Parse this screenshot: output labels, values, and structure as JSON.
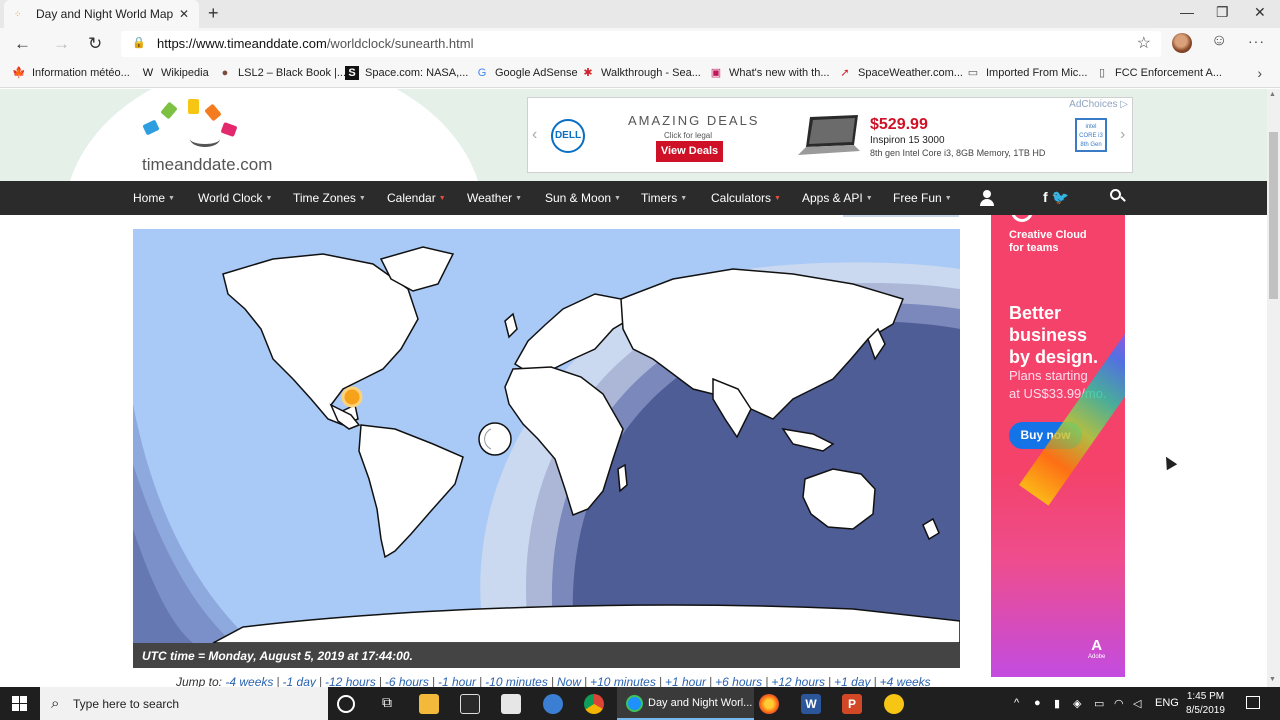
{
  "browser": {
    "tab_title": "Day and Night World Map",
    "new_tab_icon": "+",
    "url_host": "https://www.timeanddate.com",
    "url_path": "/worldclock/sunearth.html",
    "favorites": [
      {
        "label": "Information météo...",
        "icon": "maple-leaf-icon",
        "glyph": "🍁",
        "color": "#d52b1e"
      },
      {
        "label": "Wikipedia",
        "icon": "wikipedia-icon",
        "glyph": "W",
        "color": "#111"
      },
      {
        "label": "LSL2 – Black Book |...",
        "icon": "avatar-icon",
        "glyph": "●",
        "color": "#7a4a3a"
      },
      {
        "label": "Space.com: NASA,...",
        "icon": "space-com-icon",
        "glyph": "S",
        "color": "#fff"
      },
      {
        "label": "Google AdSense",
        "icon": "google-icon",
        "glyph": "G",
        "color": "#4285f4"
      },
      {
        "label": "Walkthrough - Sea...",
        "icon": "walkthrough-icon",
        "glyph": "✱",
        "color": "#d2232a"
      },
      {
        "label": "What's new with th...",
        "icon": "image-icon",
        "glyph": "▣",
        "color": "#c2185b"
      },
      {
        "label": "SpaceWeather.com...",
        "icon": "spaceweather-icon",
        "glyph": "➚",
        "color": "#d2232a"
      },
      {
        "label": "Imported From Mic...",
        "icon": "folder-icon",
        "glyph": "▭",
        "color": "#555"
      },
      {
        "label": "FCC Enforcement A...",
        "icon": "page-icon",
        "glyph": "▯",
        "color": "#555"
      }
    ]
  },
  "site": {
    "logo_text": "timeanddate.com",
    "nav": [
      "Home",
      "World Clock",
      "Time Zones",
      "Calendar",
      "Weather",
      "Sun & Moon",
      "Timers",
      "Calculators",
      "Apps & API",
      "Free Fun"
    ],
    "nav_caret": "▼",
    "social": "f 🐦"
  },
  "top_ad": {
    "adchoices": "AdChoices ▷",
    "brand": "DELL",
    "headline": "AMAZING DEALS",
    "legal": "Click for legal",
    "cta": "View Deals",
    "price": "$529.99",
    "model": "Inspiron 15 3000",
    "specs": "8th gen Intel Core i3, 8GB Memory, 1TB HD",
    "badge": "intel CORE i3 8th Gen",
    "prev": "‹",
    "next": "›"
  },
  "map": {
    "utc_text": "UTC time = Monday, August 5, 2019 at 17:44:00.",
    "jump_label": "Jump to:",
    "jump_links": [
      "-4 weeks",
      "-1 day",
      "-12 hours",
      "-6 hours",
      "-1 hour",
      "-10 minutes",
      "Now",
      "+10 minutes",
      "+1 hour",
      "+6 hours",
      "+12 hours",
      "+1 day",
      "+4 weeks"
    ],
    "colors": {
      "ocean_day": "#a9c9f7",
      "land": "#ffffff",
      "night": "#4f5d96",
      "sun": "#f7a21b"
    }
  },
  "side_ad": {
    "product": "Creative Cloud\nfor teams",
    "headline": "Better\nbusiness\nby design.",
    "plans": "Plans starting\nat US$33.99/mo.",
    "cta": "Buy now",
    "brand": "Adobe",
    "brand_mark": "A"
  },
  "taskbar": {
    "search_placeholder": "Type here to search",
    "active_window": "Day and Night Worl...",
    "lang": "ENG",
    "time": "1:45 PM",
    "date": "8/5/2019"
  }
}
